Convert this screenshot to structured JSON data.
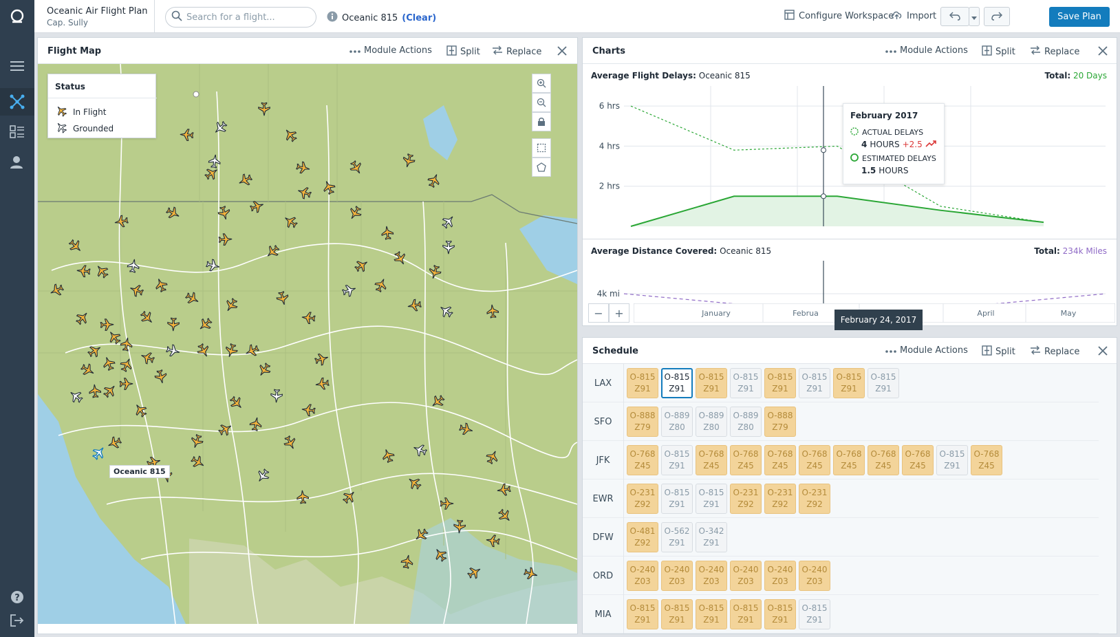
{
  "app": {
    "title": "Oceanic Air Flight Plan",
    "subtitle": "Cap. Sully"
  },
  "search": {
    "placeholder": "Search for a flight..."
  },
  "flight_info": {
    "name": "Oceanic 815",
    "clear_label": "(Clear)"
  },
  "toolbar": {
    "configure_label": "Configure Workspace",
    "import_label": "Import",
    "save_label": "Save Plan"
  },
  "module": {
    "actions_label": "Module Actions",
    "split_label": "Split",
    "replace_label": "Replace"
  },
  "map_panel": {
    "title": "Flight Map",
    "legend_title": "Status",
    "legend_in_flight": "In Flight",
    "legend_grounded": "Grounded",
    "selected_label": "Oceanic 815",
    "colors": {
      "in_flight": "#f5b53c",
      "grounded": "#ffffff"
    }
  },
  "charts_panel": {
    "title": "Charts",
    "delay_chart": {
      "title_prefix": "Average Flight Delays:",
      "title_flight": "Oceanic 815",
      "total_label": "Total:",
      "total_value": "20 Days",
      "total_color": "#29a634",
      "y_ticks": [
        "6 hrs",
        "4 hrs",
        "2 hrs"
      ],
      "tooltip": {
        "month": "February 2017",
        "actual_label": "ACTUAL DELAYS",
        "actual_value": "4",
        "actual_unit": "HOURS",
        "actual_delta": "+2.5",
        "estimated_label": "ESTIMATED DELAYS",
        "estimated_value": "1.5",
        "estimated_unit": "HOURS"
      }
    },
    "distance_chart": {
      "title_prefix": "Average Distance Covered:",
      "title_flight": "Oceanic 815",
      "total_label": "Total:",
      "total_value": "234k Miles",
      "total_color": "#8f6ac6",
      "y_tick": "4k mi"
    },
    "x_axis": [
      "January",
      "Februa",
      "ch",
      "April",
      "May"
    ],
    "cursor_date": "February 24, 2017",
    "zoom_out": "−",
    "zoom_in": "+"
  },
  "chart_data": [
    {
      "type": "line",
      "title": "Average Flight Delays: Oceanic 815",
      "x": [
        "January",
        "February",
        "March",
        "April",
        "May"
      ],
      "series": [
        {
          "name": "ACTUAL DELAYS",
          "values": [
            6,
            3.8,
            4,
            1,
            0.2
          ]
        },
        {
          "name": "ESTIMATED DELAYS",
          "values": [
            0,
            1.5,
            1.5,
            0.8,
            0.2
          ]
        }
      ],
      "ylim": [
        0,
        7
      ]
    },
    {
      "type": "line",
      "title": "Average Distance Covered: Oceanic 815",
      "x": [
        "January",
        "February",
        "March",
        "April",
        "May"
      ],
      "series": [
        {
          "name": "",
          "values": [
            4,
            3,
            2.5,
            3,
            4
          ]
        }
      ]
    }
  ],
  "schedule_panel": {
    "title": "Schedule",
    "rows": [
      {
        "airport": "LAX",
        "flights": [
          {
            "code": "O-815",
            "zone": "Z91",
            "state": "y"
          },
          {
            "code": "O-815",
            "zone": "Z91",
            "state": "sel"
          },
          {
            "code": "O-815",
            "zone": "Z91",
            "state": "y"
          },
          {
            "code": "O-815",
            "zone": "Z91",
            "state": "g"
          },
          {
            "code": "O-815",
            "zone": "Z91",
            "state": "y"
          },
          {
            "code": "O-815",
            "zone": "Z91",
            "state": "g"
          },
          {
            "code": "O-815",
            "zone": "Z91",
            "state": "y"
          },
          {
            "code": "O-815",
            "zone": "Z91",
            "state": "g"
          }
        ]
      },
      {
        "airport": "SFO",
        "flights": [
          {
            "code": "O-888",
            "zone": "Z79",
            "state": "y"
          },
          {
            "code": "O-889",
            "zone": "Z80",
            "state": "g"
          },
          {
            "code": "O-889",
            "zone": "Z80",
            "state": "g"
          },
          {
            "code": "O-889",
            "zone": "Z80",
            "state": "g"
          },
          {
            "code": "O-888",
            "zone": "Z79",
            "state": "y"
          }
        ]
      },
      {
        "airport": "JFK",
        "flights": [
          {
            "code": "O-768",
            "zone": "Z45",
            "state": "y"
          },
          {
            "code": "O-815",
            "zone": "Z91",
            "state": "g"
          },
          {
            "code": "O-768",
            "zone": "Z45",
            "state": "y"
          },
          {
            "code": "O-768",
            "zone": "Z45",
            "state": "y"
          },
          {
            "code": "O-768",
            "zone": "Z45",
            "state": "y"
          },
          {
            "code": "O-768",
            "zone": "Z45",
            "state": "y"
          },
          {
            "code": "O-768",
            "zone": "Z45",
            "state": "y"
          },
          {
            "code": "O-768",
            "zone": "Z45",
            "state": "y"
          },
          {
            "code": "O-768",
            "zone": "Z45",
            "state": "y"
          },
          {
            "code": "O-815",
            "zone": "Z91",
            "state": "g"
          },
          {
            "code": "O-768",
            "zone": "Z45",
            "state": "y"
          }
        ]
      },
      {
        "airport": "EWR",
        "flights": [
          {
            "code": "O-231",
            "zone": "Z92",
            "state": "y"
          },
          {
            "code": "O-815",
            "zone": "Z91",
            "state": "g"
          },
          {
            "code": "O-815",
            "zone": "Z91",
            "state": "g"
          },
          {
            "code": "O-231",
            "zone": "Z92",
            "state": "y"
          },
          {
            "code": "O-231",
            "zone": "Z92",
            "state": "y"
          },
          {
            "code": "O-231",
            "zone": "Z92",
            "state": "y"
          }
        ]
      },
      {
        "airport": "DFW",
        "flights": [
          {
            "code": "O-481",
            "zone": "Z92",
            "state": "y"
          },
          {
            "code": "O-562",
            "zone": "Z91",
            "state": "g"
          },
          {
            "code": "O-342",
            "zone": "Z91",
            "state": "g"
          }
        ]
      },
      {
        "airport": "ORD",
        "flights": [
          {
            "code": "O-240",
            "zone": "Z03",
            "state": "y"
          },
          {
            "code": "O-240",
            "zone": "Z03",
            "state": "y"
          },
          {
            "code": "O-240",
            "zone": "Z03",
            "state": "y"
          },
          {
            "code": "O-240",
            "zone": "Z03",
            "state": "y"
          },
          {
            "code": "O-240",
            "zone": "Z03",
            "state": "y"
          },
          {
            "code": "O-240",
            "zone": "Z03",
            "state": "y"
          }
        ]
      },
      {
        "airport": "MIA",
        "flights": [
          {
            "code": "O-815",
            "zone": "Z91",
            "state": "y"
          },
          {
            "code": "O-815",
            "zone": "Z91",
            "state": "y"
          },
          {
            "code": "O-815",
            "zone": "Z91",
            "state": "y"
          },
          {
            "code": "O-815",
            "zone": "Z91",
            "state": "y"
          },
          {
            "code": "O-815",
            "zone": "Z91",
            "state": "y"
          },
          {
            "code": "O-815",
            "zone": "Z91",
            "state": "g"
          }
        ]
      }
    ]
  }
}
